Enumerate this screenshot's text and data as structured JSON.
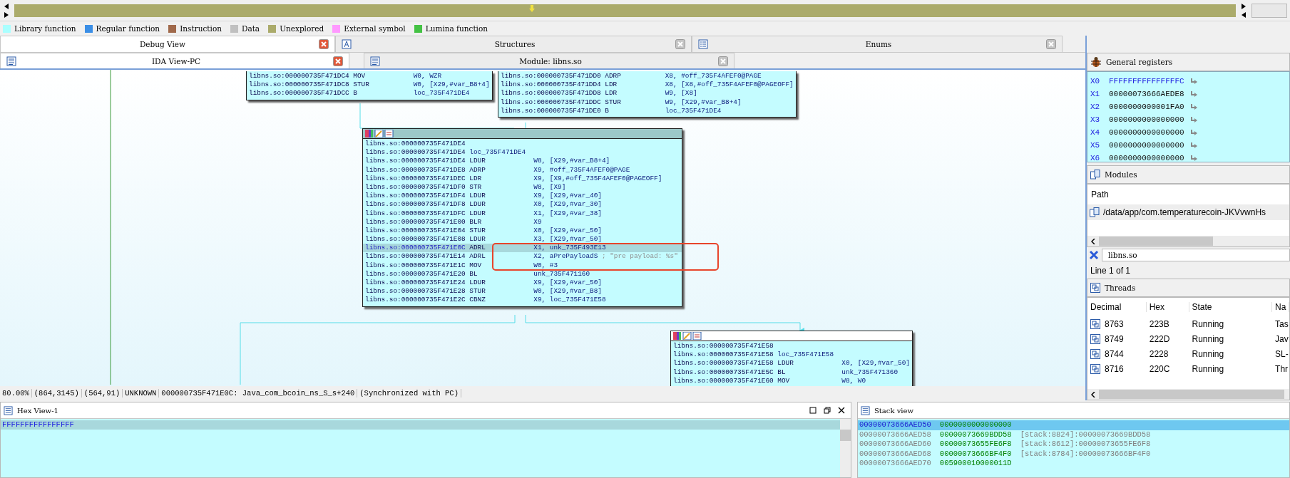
{
  "legend": [
    {
      "label": "Library function",
      "color": "#aaffff"
    },
    {
      "label": "Regular function",
      "color": "#3a8ee6"
    },
    {
      "label": "Instruction",
      "color": "#a0694b"
    },
    {
      "label": "Data",
      "color": "#c0c0c0"
    },
    {
      "label": "Unexplored",
      "color": "#abab6b"
    },
    {
      "label": "External symbol",
      "color": "#ff99ff"
    },
    {
      "label": "Lumina function",
      "color": "#44c244"
    }
  ],
  "tabs_top": [
    {
      "label": "Debug View",
      "selected": true
    },
    {
      "label": "Structures",
      "selected": false
    },
    {
      "label": "Enums",
      "selected": false
    }
  ],
  "tabs_view": [
    {
      "label": "IDA View-PC",
      "selected": true
    },
    {
      "label": "Module: libns.so",
      "selected": false
    }
  ],
  "graph": {
    "nodes": [
      {
        "header": false,
        "lines": [
          {
            "address": "libns.so:000000735F471DC4",
            "mnemonic": "MOV",
            "operands": "W0, WZR",
            "current": false
          },
          {
            "address": "libns.so:000000735F471DC8",
            "mnemonic": "STUR",
            "operands": "W0, [X29,#var_B8+4]",
            "current": false
          },
          {
            "address": "libns.so:000000735F471DCC",
            "mnemonic": "B",
            "operands": "loc_735F471DE4",
            "current": false
          }
        ]
      },
      {
        "header": false,
        "lines": [
          {
            "address": "libns.so:000000735F471DD0",
            "mnemonic": "ADRP",
            "operands": "X8, #off_735F4AFEF0@PAGE",
            "current": false
          },
          {
            "address": "libns.so:000000735F471DD4",
            "mnemonic": "LDR",
            "operands": "X8, [X8,#off_735F4AFEF0@PAGEOFF]",
            "current": false
          },
          {
            "address": "libns.so:000000735F471DD8",
            "mnemonic": "LDR",
            "operands": "W9, [X8]",
            "current": false
          },
          {
            "address": "libns.so:000000735F471DDC",
            "mnemonic": "STUR",
            "operands": "W9, [X29,#var_B8+4]",
            "current": false
          },
          {
            "address": "libns.so:000000735F471DE0",
            "mnemonic": "B",
            "operands": "loc_735F471DE4",
            "current": false
          }
        ]
      },
      {
        "header": true,
        "lines": [
          {
            "address": "libns.so:000000735F471DE4",
            "current": false
          },
          {
            "address": "libns.so:000000735F471DE4",
            "label": "loc_735F471DE4",
            "current": false
          },
          {
            "address": "libns.so:000000735F471DE4",
            "mnemonic": "LDUR",
            "operands": "W8, [X29,#var_B8+4]",
            "current": false
          },
          {
            "address": "libns.so:000000735F471DE8",
            "mnemonic": "ADRP",
            "operands": "X9, #off_735F4AFEF0@PAGE",
            "current": false
          },
          {
            "address": "libns.so:000000735F471DEC",
            "mnemonic": "LDR",
            "operands": "X9, [X9,#off_735F4AFEF0@PAGEOFF]",
            "current": false
          },
          {
            "address": "libns.so:000000735F471DF0",
            "mnemonic": "STR",
            "operands": "W8, [X9]",
            "current": false
          },
          {
            "address": "libns.so:000000735F471DF4",
            "mnemonic": "LDUR",
            "operands": "X9, [X29,#var_40]",
            "current": false
          },
          {
            "address": "libns.so:000000735F471DF8",
            "mnemonic": "LDUR",
            "operands": "X0, [X29,#var_30]",
            "current": false
          },
          {
            "address": "libns.so:000000735F471DFC",
            "mnemonic": "LDUR",
            "operands": "X1, [X29,#var_38]",
            "current": false
          },
          {
            "address": "libns.so:000000735F471E00",
            "mnemonic": "BLR",
            "operands": "X9",
            "current": false
          },
          {
            "address": "libns.so:000000735F471E04",
            "mnemonic": "STUR",
            "operands": "X0, [X29,#var_50]",
            "current": false
          },
          {
            "address": "libns.so:000000735F471E08",
            "mnemonic": "LDUR",
            "operands": "X3, [X29,#var_50]",
            "current": false
          },
          {
            "address": "libns.so:000000735F471E0C",
            "mnemonic": "ADRL",
            "operands": "X1, unk_735F493E13",
            "current": true
          },
          {
            "address": "libns.so:000000735F471E14",
            "mnemonic": "ADRL",
            "operands": "X2, aPrePayloadS",
            "comment": "; \"pre payload: %s\"",
            "current": false
          },
          {
            "address": "libns.so:000000735F471E1C",
            "mnemonic": "MOV",
            "operands": "W0, #3",
            "current": false
          },
          {
            "address": "libns.so:000000735F471E20",
            "mnemonic": "BL",
            "operands": "unk_735F471160",
            "current": false
          },
          {
            "address": "libns.so:000000735F471E24",
            "mnemonic": "LDUR",
            "operands": "X9, [X29,#var_50]",
            "current": false
          },
          {
            "address": "libns.so:000000735F471E28",
            "mnemonic": "STUR",
            "operands": "W0, [X29,#var_B8]",
            "current": false
          },
          {
            "address": "libns.so:000000735F471E2C",
            "mnemonic": "CBNZ",
            "operands": "X9, loc_735F471E58",
            "current": false
          }
        ]
      },
      {
        "header": true,
        "lines": [
          {
            "address": "libns.so:000000735F471E58",
            "current": false
          },
          {
            "address": "libns.so:000000735F471E58",
            "label": "loc_735F471E58",
            "current": false
          },
          {
            "address": "libns.so:000000735F471E58",
            "mnemonic": "LDUR",
            "operands": "X0, [X29,#var_50]",
            "current": false
          },
          {
            "address": "libns.so:000000735F471E5C",
            "mnemonic": "BL",
            "operands": "unk_735F471360",
            "current": false
          },
          {
            "address": "libns.so:000000735F471E60",
            "mnemonic": "MOV",
            "operands": "W8, W0",
            "current": false
          }
        ]
      }
    ],
    "annotation": {
      "kind": "box"
    }
  },
  "status_bar": [
    "80.00%",
    "(864,3145)",
    "(564,91)",
    "UNKNOWN",
    "000000735F471E0C: Java_com_bcoin_ns_S_s+240",
    "(Synchronized with PC)"
  ],
  "registers": {
    "title": "General registers",
    "rows": [
      {
        "name": "X0",
        "value": "FFFFFFFFFFFFFFFC",
        "changed": true
      },
      {
        "name": "X1",
        "value": "00000073666AEDE8",
        "changed": false
      },
      {
        "name": "X2",
        "value": "0000000000001FA0",
        "changed": false
      },
      {
        "name": "X3",
        "value": "0000000000000000",
        "changed": false
      },
      {
        "name": "X4",
        "value": "0000000000000000",
        "changed": false
      },
      {
        "name": "X5",
        "value": "0000000000000000",
        "changed": false
      },
      {
        "name": "X6",
        "value": "0000000000000000",
        "changed": false
      }
    ]
  },
  "modules": {
    "title": "Modules",
    "column": "Path",
    "rows": [
      "/data/app/com.temperaturecoin-JKVvwnHs"
    ],
    "filter": "libns.so",
    "line_info": "Line 1 of 1"
  },
  "threads": {
    "title": "Threads",
    "columns": [
      "Decimal",
      "Hex",
      "State",
      "Na"
    ],
    "rows": [
      {
        "decimal": "8763",
        "hex": "223B",
        "state": "Running",
        "name": "Tas"
      },
      {
        "decimal": "8749",
        "hex": "222D",
        "state": "Running",
        "name": "Jav"
      },
      {
        "decimal": "8744",
        "hex": "2228",
        "state": "Running",
        "name": "SL-"
      },
      {
        "decimal": "8716",
        "hex": "220C",
        "state": "Running",
        "name": "Thr"
      }
    ]
  },
  "hex_view": {
    "title": "Hex View-1",
    "rows": [
      {
        "text": "FFFFFFFFFFFFFFFF",
        "selected": true
      }
    ]
  },
  "stack_view": {
    "title": "Stack view",
    "rows": [
      {
        "address": "00000073666AED50",
        "value": "0000000000000000",
        "selected": true
      },
      {
        "address": "00000073666AED58",
        "value": "00000073669BDD58",
        "comment": "[stack:8824]:00000073669BDD58",
        "selected": false
      },
      {
        "address": "00000073666AED60",
        "value": "00000073655FE6F8",
        "comment": "[stack:8612]:00000073655FE6F8",
        "selected": false
      },
      {
        "address": "00000073666AED68",
        "value": "00000073666BF4F0",
        "comment": "[stack:8784]:00000073666BF4F0",
        "selected": false
      },
      {
        "address": "00000073666AED70",
        "value": "005900010000011D",
        "selected": false
      }
    ]
  }
}
